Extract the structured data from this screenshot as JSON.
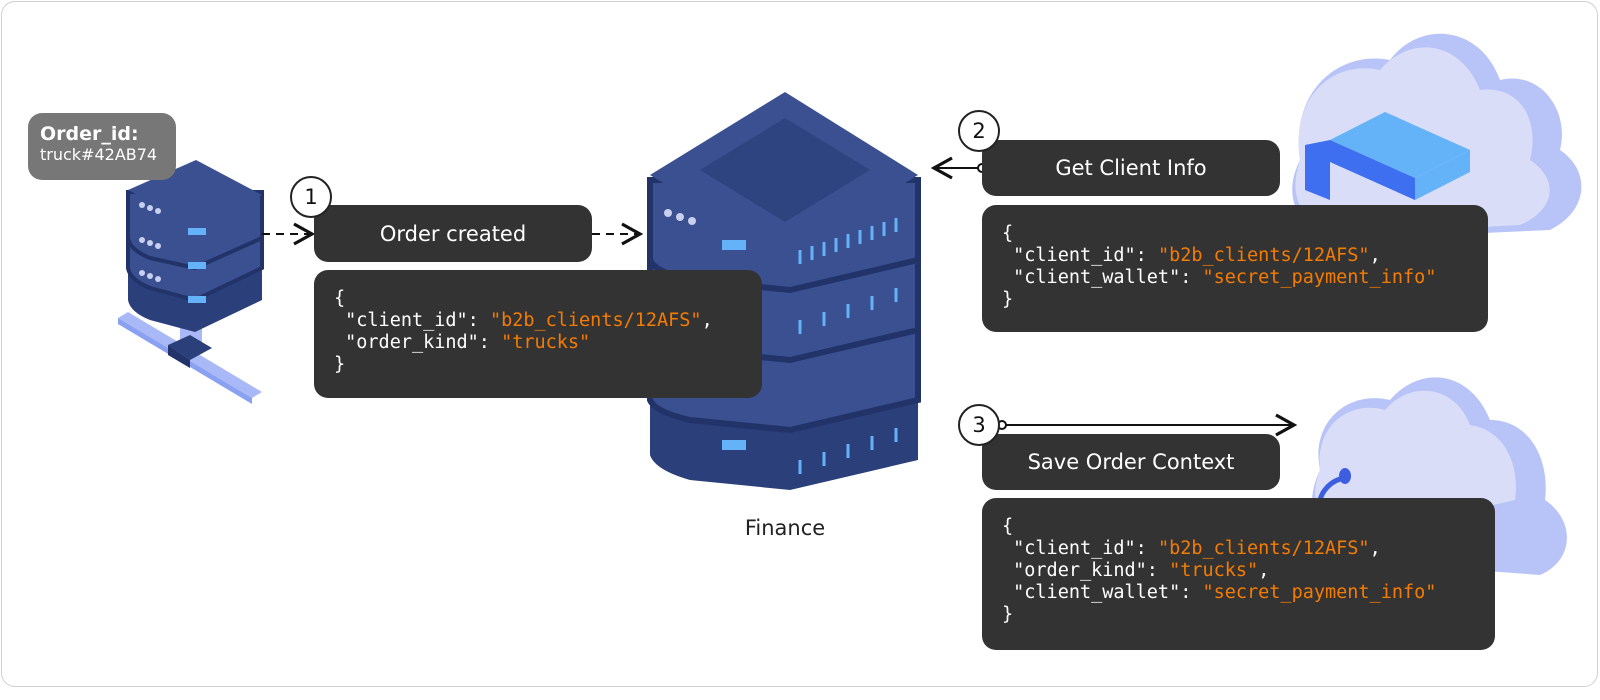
{
  "source_node": {
    "title": "Order_id:",
    "value": "truck#42AB74"
  },
  "center_node": {
    "label": "Finance"
  },
  "steps": [
    {
      "number": "1",
      "label": "Order created",
      "code": [
        [
          "{",
          ""
        ],
        [
          " \"client_id\": ",
          "\"b2b_clients/12AFS\"",
          ","
        ],
        [
          " \"order_kind\": ",
          "\"trucks\"",
          ""
        ],
        [
          "}",
          ""
        ]
      ]
    },
    {
      "number": "2",
      "label": "Get Client Info",
      "code": [
        [
          "{",
          ""
        ],
        [
          " \"client_id\": ",
          "\"b2b_clients/12AFS\"",
          ","
        ],
        [
          " \"client_wallet\": ",
          "\"secret_payment_info\"",
          ""
        ],
        [
          "}",
          ""
        ]
      ]
    },
    {
      "number": "3",
      "label": "Save Order Context",
      "code": [
        [
          "{",
          ""
        ],
        [
          " \"client_id\": ",
          "\"b2b_clients/12AFS\"",
          ","
        ],
        [
          " \"order_kind\": ",
          "\"trucks\"",
          ","
        ],
        [
          " \"client_wallet\": ",
          "\"secret_payment_info\"",
          ""
        ],
        [
          "}",
          ""
        ]
      ]
    }
  ],
  "colors": {
    "server_dark": "#2b3f7a",
    "server_mid": "#3a5090",
    "cloud": "#d9ddf7",
    "cloud_shade": "#b8c4f7",
    "cloud_server": "#64b2f8",
    "string": "#f57c00",
    "box": "#333333"
  }
}
